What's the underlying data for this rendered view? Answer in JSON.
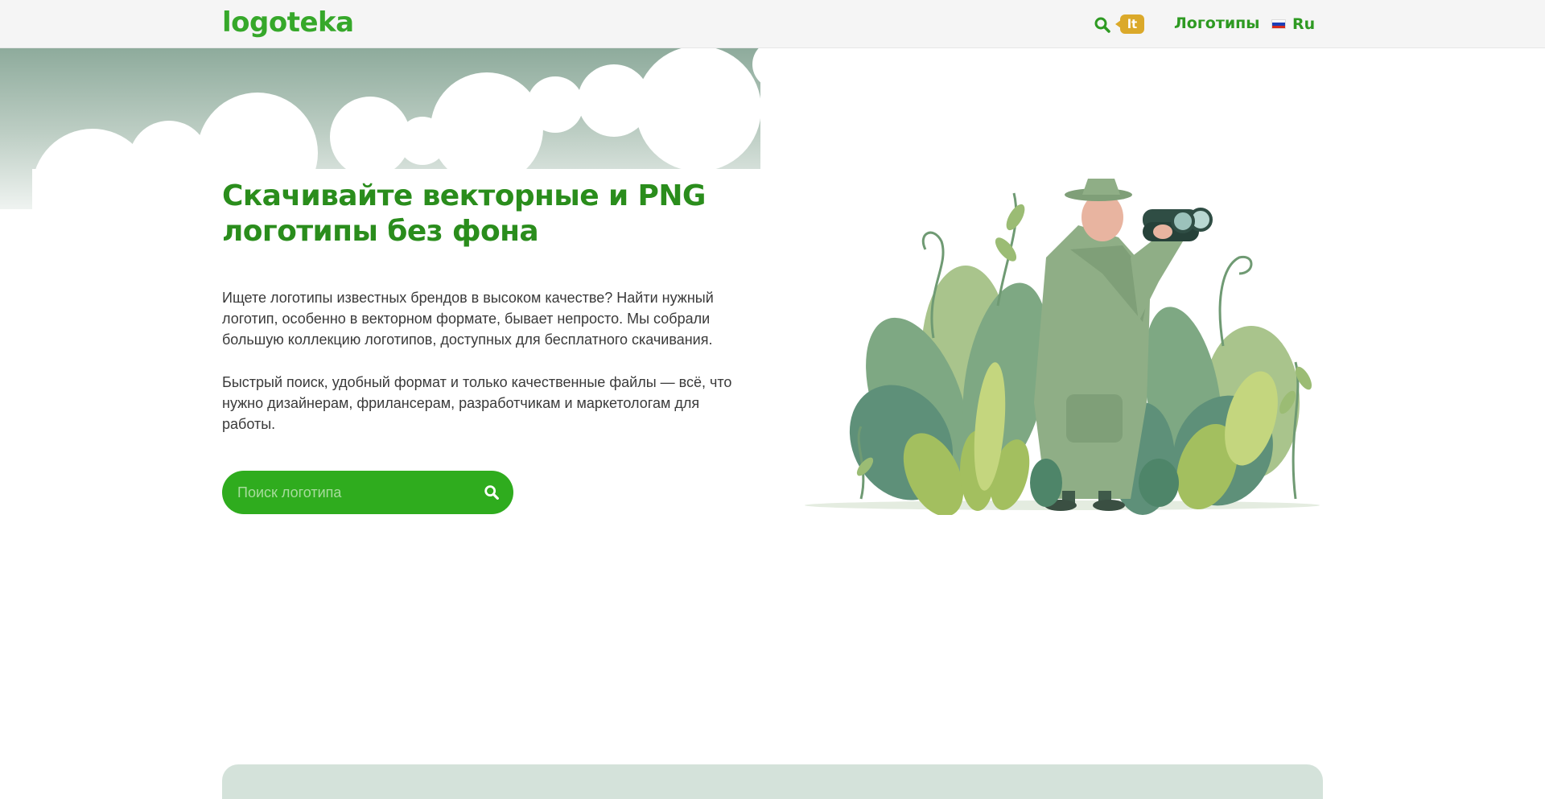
{
  "header": {
    "logo_text": "logoteka",
    "search_icon": "search-icon",
    "badge_text": "lt",
    "nav_link_label": "Логотипы",
    "language_label": "Ru",
    "flag_colors": [
      "#ffffff",
      "#1c3fb8",
      "#d52b1e"
    ]
  },
  "hero": {
    "title": "Скачивайте векторные и PNG логотипы без фона",
    "paragraph_1": "Ищете логотипы известных брендов в высоком качестве? Найти нужный логотип, особенно в векторном формате, бывает непросто. Мы собрали большую коллекцию логотипов, доступных для бесплатного скачивания.",
    "paragraph_2": "Быстрый поиск, удобный формат и только качественные файлы — всё, что нужно дизайнерам, фрилансерам, разработчикам и маркетологам для работы.",
    "search_placeholder": "Поиск логотипа"
  },
  "colors": {
    "brand_green": "#2fac1e",
    "title_green": "#2a8d1c",
    "badge_yellow": "#dba92a",
    "panel_gray_green": "#d4e2da"
  }
}
